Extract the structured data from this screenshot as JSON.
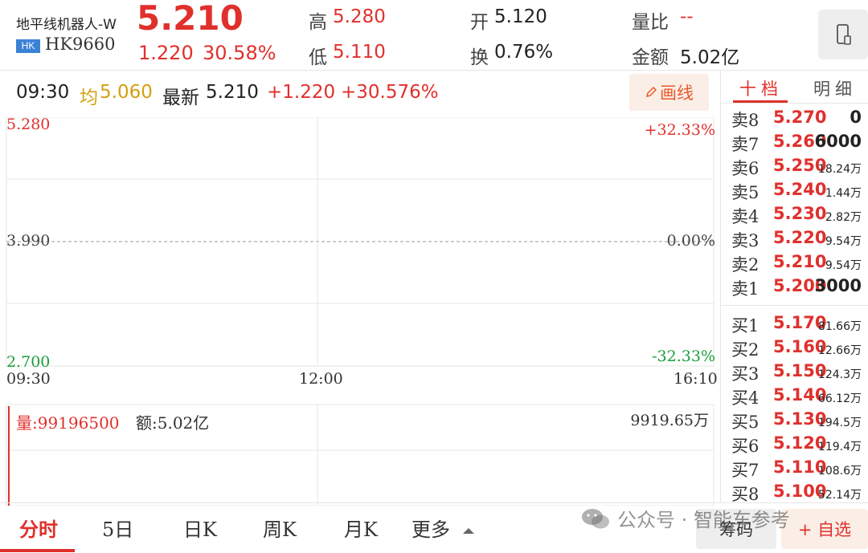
{
  "header": {
    "stock_name": "地平线机器人-W",
    "badge": "HK",
    "stock_code": "HK9660",
    "price": "5.210",
    "change": "1.220",
    "change_pct": "30.58%",
    "high_label": "高",
    "high_value": "5.280",
    "low_label": "低",
    "low_value": "5.110",
    "open_label": "开",
    "open_value": "5.120",
    "turnover_label": "换",
    "turnover_value": "0.76%",
    "volume_ratio_label": "量比",
    "volume_ratio_value": "--",
    "amount_label": "金额",
    "amount_value": "5.02亿",
    "mobile_icon": "mobile-phone-icon"
  },
  "info_bar": {
    "time": "09:30",
    "avg_label": "均",
    "avg_value": "5.060",
    "latest_label": "最新",
    "latest_value": "5.210",
    "change": "+1.220",
    "change_pct": "+30.576%",
    "draw_label": "画线",
    "draw_icon": "pencil-icon"
  },
  "chart": {
    "price_top": "5.280",
    "price_mid": "3.990",
    "price_bottom": "2.700",
    "pct_top": "+32.33%",
    "pct_mid": "0.00%",
    "pct_bottom": "-32.33%",
    "time_start": "09:30",
    "time_mid": "12:00",
    "time_end": "16:10",
    "volume_label": "量:99196500",
    "amount_label": "额:5.02亿",
    "volume_max": "9919.65万",
    "colors": {
      "up": "#e0302c",
      "down": "#1a9e3a",
      "grid": "#e5e5e5"
    }
  },
  "chart_data": {
    "type": "line",
    "x": [
      "09:30"
    ],
    "series": [],
    "ylim": [
      2.7,
      5.28
    ],
    "pct_range": [
      "-32.33%",
      "+32.33%"
    ],
    "xlabel": "",
    "ylabel": "",
    "grid": true
  },
  "order_book": {
    "tabs": [
      "十档",
      "明细"
    ],
    "asks": [
      {
        "label": "卖8",
        "price": "5.270",
        "volume": "0",
        "small": false
      },
      {
        "label": "卖7",
        "price": "5.260",
        "volume": "6000",
        "small": false
      },
      {
        "label": "卖6",
        "price": "5.250",
        "volume": "18.24万",
        "small": true
      },
      {
        "label": "卖5",
        "price": "5.240",
        "volume": "1.44万",
        "small": true
      },
      {
        "label": "卖4",
        "price": "5.230",
        "volume": "2.82万",
        "small": true
      },
      {
        "label": "卖3",
        "price": "5.220",
        "volume": "9.54万",
        "small": true
      },
      {
        "label": "卖2",
        "price": "5.210",
        "volume": "9.54万",
        "small": true
      },
      {
        "label": "卖1",
        "price": "5.200",
        "volume": "3000",
        "small": false
      }
    ],
    "bids": [
      {
        "label": "买1",
        "price": "5.170",
        "volume": "81.66万",
        "small": true
      },
      {
        "label": "买2",
        "price": "5.160",
        "volume": "12.66万",
        "small": true
      },
      {
        "label": "买3",
        "price": "5.150",
        "volume": "124.3万",
        "small": true
      },
      {
        "label": "买4",
        "price": "5.140",
        "volume": "66.12万",
        "small": true
      },
      {
        "label": "买5",
        "price": "5.130",
        "volume": "194.5万",
        "small": true
      },
      {
        "label": "买6",
        "price": "5.120",
        "volume": "119.4万",
        "small": true
      },
      {
        "label": "买7",
        "price": "5.110",
        "volume": "108.6万",
        "small": true
      },
      {
        "label": "买8",
        "price": "5.100",
        "volume": "52.14万",
        "small": true
      }
    ]
  },
  "bottom_nav": {
    "tabs": [
      "分时",
      "5日",
      "日K",
      "周K",
      "月K",
      "更多"
    ],
    "more_icon": "triangle-up-icon",
    "chips_label": "筹码",
    "watchlist_label": "+ 自选",
    "watermark": "公众号 · 智能车参考",
    "wechat_icon": "wechat-icon"
  }
}
